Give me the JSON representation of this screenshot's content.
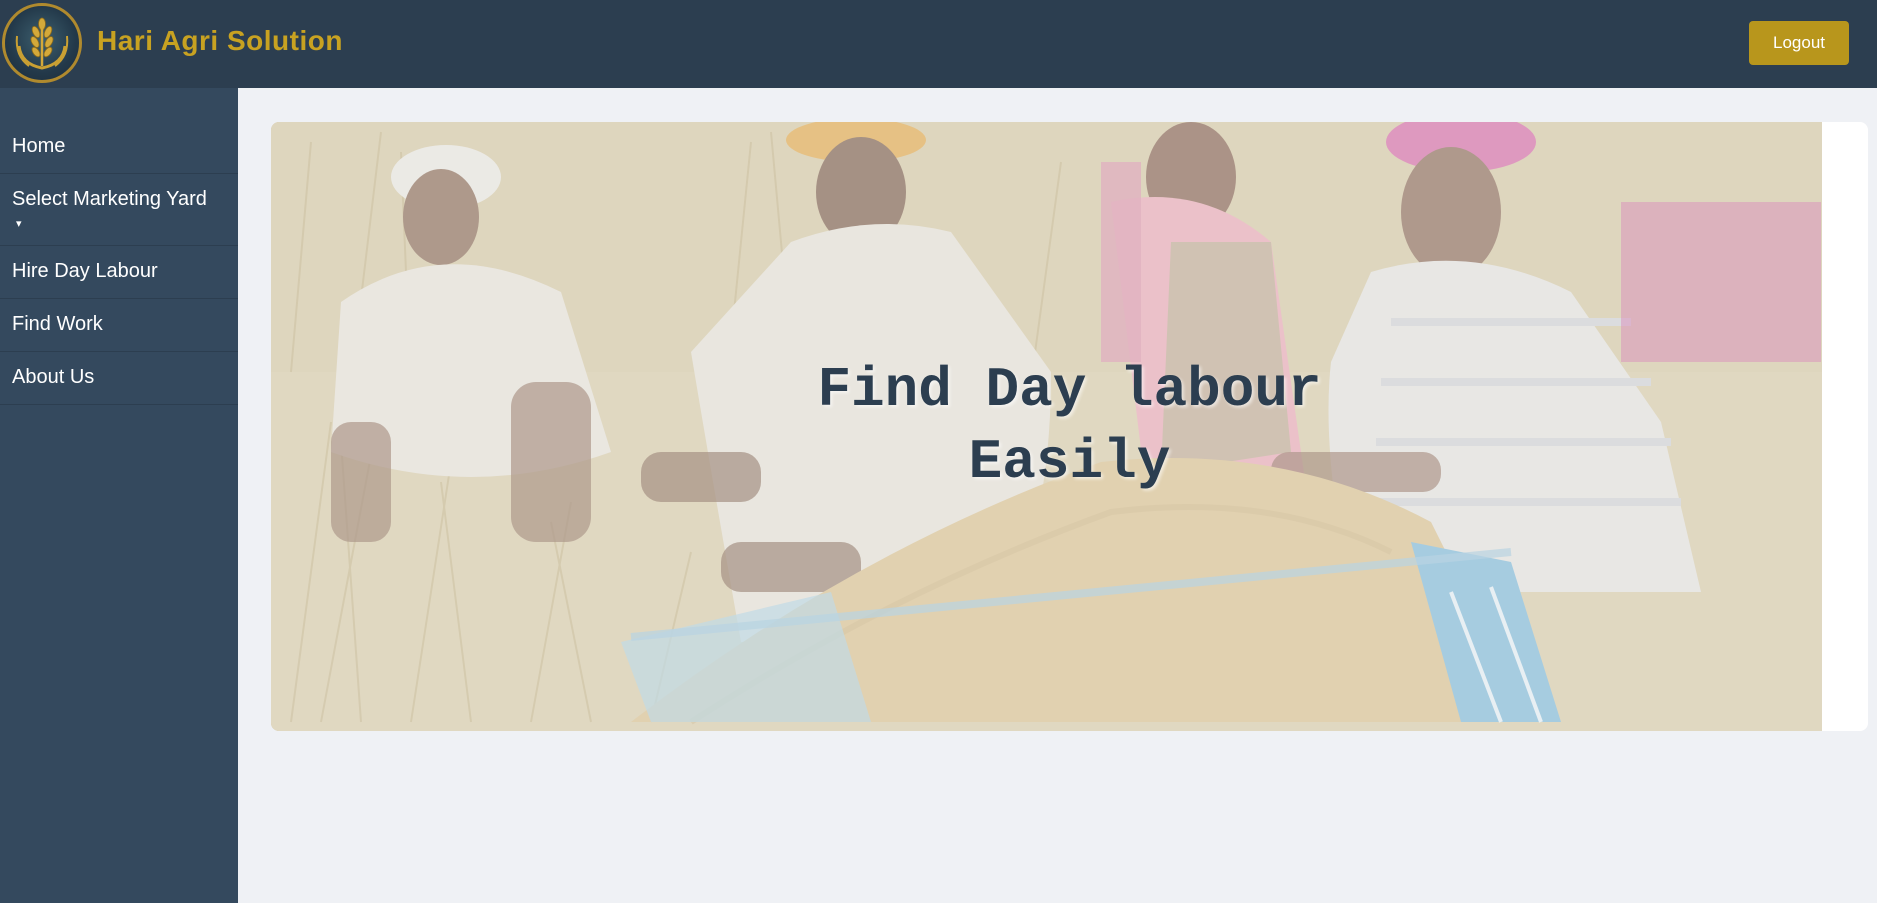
{
  "header": {
    "brand": "Hari Agri Solution",
    "logout_label": "Logout",
    "logo_icon": "wheat-emblem-icon"
  },
  "sidebar": {
    "items": [
      {
        "label": "Home"
      },
      {
        "label": "Select Marketing Yard",
        "caret": "▾"
      },
      {
        "label": "Hire Day Labour"
      },
      {
        "label": "Find Work"
      },
      {
        "label": "About Us"
      }
    ]
  },
  "hero": {
    "line1": "Find Day labour",
    "line2": "Easily"
  },
  "colors": {
    "header_bg": "#2c3e50",
    "sidebar_bg": "#34495e",
    "accent": "#c8a221",
    "button_bg": "#b8961c",
    "page_bg": "#eff1f5"
  }
}
